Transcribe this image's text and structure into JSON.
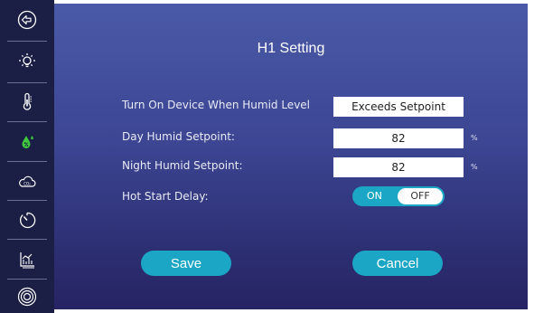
{
  "screen": {
    "title": "H1 Setting"
  },
  "sidebar": {
    "items": [
      {
        "icon": "back-arrow-icon"
      },
      {
        "icon": "light-bulb-icon"
      },
      {
        "icon": "thermometer-icon"
      },
      {
        "icon": "humidity-drop-icon",
        "active": true
      },
      {
        "icon": "co2-cloud-icon"
      },
      {
        "icon": "timer-icon"
      },
      {
        "icon": "chart-icon"
      },
      {
        "icon": "target-icon"
      }
    ]
  },
  "form": {
    "trigger": {
      "label": "Turn On Device When Humid Level",
      "value": "Exceeds Setpoint"
    },
    "day_setpoint": {
      "label": "Day Humid Setpoint:",
      "value": "82",
      "unit": "%"
    },
    "night_setpoint": {
      "label": "Night Humid Setpoint:",
      "value": "82",
      "unit": "%"
    },
    "hot_start_delay": {
      "label": "Hot Start Delay:",
      "on_label": "ON",
      "off_label": "OFF",
      "state": "OFF"
    }
  },
  "actions": {
    "save_label": "Save",
    "cancel_label": "Cancel"
  },
  "colors": {
    "sidebar_bg": "#1b1e45",
    "accent": "#1aa6c4",
    "active_icon": "#3ec93e"
  }
}
